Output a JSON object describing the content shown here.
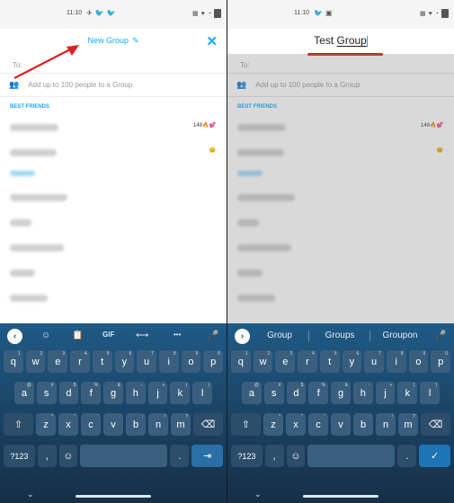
{
  "left": {
    "status": {
      "time": "11:10",
      "left_icons": [
        "✈",
        "🐦",
        "🐦"
      ],
      "right_icons": [
        "▦",
        "♥",
        "◔"
      ]
    },
    "header": {
      "title": "New Group",
      "pencil_icon": "pencil-icon",
      "close_icon": "close-icon",
      "close_glyph": "✕"
    },
    "to_label": "To:",
    "add_hint": "Add up to 100 people to a Group",
    "section": "BEST FRIENDS",
    "contacts": [
      {
        "right": "148🔥💕"
      },
      {
        "right": "😊"
      },
      {
        "right": ""
      },
      {
        "right": ""
      },
      {
        "right": ""
      },
      {
        "right": ""
      },
      {
        "right": ""
      },
      {
        "right": ""
      }
    ],
    "keyboard": {
      "toolbar": [
        "chevron-left-icon",
        "sticker-icon",
        "clipboard-icon",
        "GIF",
        "translate-icon",
        "more-icon",
        "mic-icon"
      ],
      "toolbar_glyphs": [
        "‹",
        "☺",
        "📋",
        "GIF",
        "⟷",
        "•••",
        "🎤"
      ],
      "row1": [
        "q",
        "w",
        "e",
        "r",
        "t",
        "y",
        "u",
        "i",
        "o",
        "p"
      ],
      "row1_hints": [
        "1",
        "2",
        "3",
        "4",
        "5",
        "6",
        "7",
        "8",
        "9",
        "0"
      ],
      "row2": [
        "a",
        "s",
        "d",
        "f",
        "g",
        "h",
        "j",
        "k",
        "l"
      ],
      "row2_hints": [
        "@",
        "#",
        "$",
        "%",
        "&",
        "-",
        "+",
        "(",
        ")"
      ],
      "row3": [
        "⇧",
        "z",
        "x",
        "c",
        "v",
        "b",
        "n",
        "m",
        "⌫"
      ],
      "row3_hints": [
        "",
        "*",
        "\"",
        "'",
        ":",
        ";",
        "!",
        "?",
        ""
      ],
      "row4": {
        "num": "?123",
        "comma": ",",
        "emoji": "☺",
        "period": ".",
        "action": "⇥"
      },
      "nav_down": "⌄"
    }
  },
  "right": {
    "status": {
      "time": "11:10",
      "left_icons": [
        "🐦",
        "▣"
      ],
      "right_icons": [
        "▦",
        "♥",
        "◔"
      ]
    },
    "header": {
      "title_part1": "Test ",
      "title_part2": "Group"
    },
    "to_label": "To:",
    "add_hint": "Add up to 100 people to a Group",
    "section": "BEST FRIENDS",
    "contacts": [
      {
        "right": "148🔥💕"
      },
      {
        "right": "😊"
      },
      {
        "right": ""
      },
      {
        "right": ""
      },
      {
        "right": ""
      },
      {
        "right": ""
      },
      {
        "right": ""
      },
      {
        "right": ""
      }
    ],
    "keyboard": {
      "suggestions": [
        "Group",
        "Groups",
        "Groupon"
      ],
      "chevron": "›",
      "mic": "🎤",
      "row1": [
        "q",
        "w",
        "e",
        "r",
        "t",
        "y",
        "u",
        "i",
        "o",
        "p"
      ],
      "row1_hints": [
        "1",
        "2",
        "3",
        "4",
        "5",
        "6",
        "7",
        "8",
        "9",
        "0"
      ],
      "row2": [
        "a",
        "s",
        "d",
        "f",
        "g",
        "h",
        "j",
        "k",
        "l"
      ],
      "row2_hints": [
        "@",
        "#",
        "$",
        "%",
        "&",
        "-",
        "+",
        "(",
        ")"
      ],
      "row3": [
        "⇧",
        "z",
        "x",
        "c",
        "v",
        "b",
        "n",
        "m",
        "⌫"
      ],
      "row3_hints": [
        "",
        "*",
        "\"",
        "'",
        ":",
        ";",
        "!",
        "?",
        ""
      ],
      "row4": {
        "num": "?123",
        "comma": ",",
        "emoji": "☺",
        "period": ".",
        "action": "✓"
      },
      "nav_down": "⌄"
    }
  },
  "colors": {
    "accent": "#0fadff",
    "annotation_red": "#e02020",
    "keyboard_bg": "#1f5a86"
  }
}
